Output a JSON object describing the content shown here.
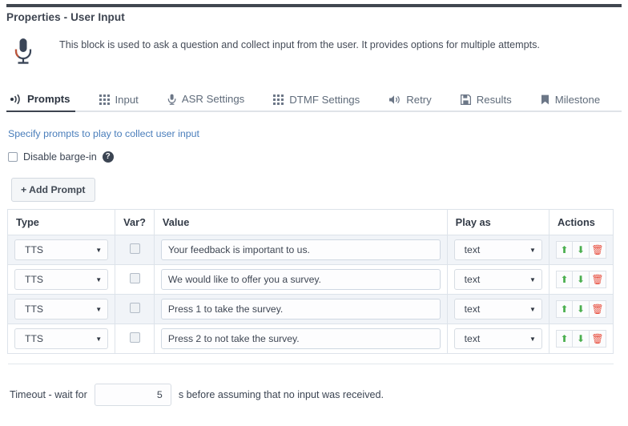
{
  "window": {
    "title": "Properties - User Input",
    "description": "This block is used to ask a question and collect input from the user. It provides options for multiple attempts.",
    "block_icon": "microphone-icon"
  },
  "tabs": [
    {
      "label": "Prompts",
      "icon": "sound-waves-icon",
      "active": true
    },
    {
      "label": "Input",
      "icon": "grid-icon",
      "active": false
    },
    {
      "label": "ASR Settings",
      "icon": "microphone-icon",
      "active": false
    },
    {
      "label": "DTMF Settings",
      "icon": "grid-icon",
      "active": false
    },
    {
      "label": "Retry",
      "icon": "speaker-icon",
      "active": false
    },
    {
      "label": "Results",
      "icon": "save-disk-icon",
      "active": false
    },
    {
      "label": "Milestone",
      "icon": "bookmark-icon",
      "active": false
    }
  ],
  "prompts_panel": {
    "subtitle_link": "Specify prompts to play to collect user input",
    "disable_barge_in": {
      "label": "Disable barge-in",
      "checked": false,
      "help_icon": "question-mark-icon"
    },
    "add_prompt_label": "+ Add Prompt",
    "table": {
      "columns": [
        "Type",
        "Var?",
        "Value",
        "Play as",
        "Actions"
      ],
      "rows": [
        {
          "type": "TTS",
          "var": false,
          "value": "Your feedback is important to us.",
          "play_as": "text"
        },
        {
          "type": "TTS",
          "var": false,
          "value": "We would like to offer you a survey.",
          "play_as": "text"
        },
        {
          "type": "TTS",
          "var": false,
          "value": "Press 1 to take the survey.",
          "play_as": "text"
        },
        {
          "type": "TTS",
          "var": false,
          "value": "Press 2 to not take the survey.",
          "play_as": "text"
        }
      ],
      "action_icons": [
        "move-up-icon",
        "move-down-icon",
        "delete-icon"
      ]
    }
  },
  "timeout": {
    "label_before": "Timeout - wait for",
    "value": "5",
    "label_after": "s before assuming that no input was received."
  },
  "colors": {
    "link": "#4a7ebb",
    "accent_dark": "#3d4450",
    "row_stripe": "#f1f4f8",
    "action_up": "#4caf50",
    "action_down": "#4caf50",
    "action_delete": "#e74c3c"
  }
}
